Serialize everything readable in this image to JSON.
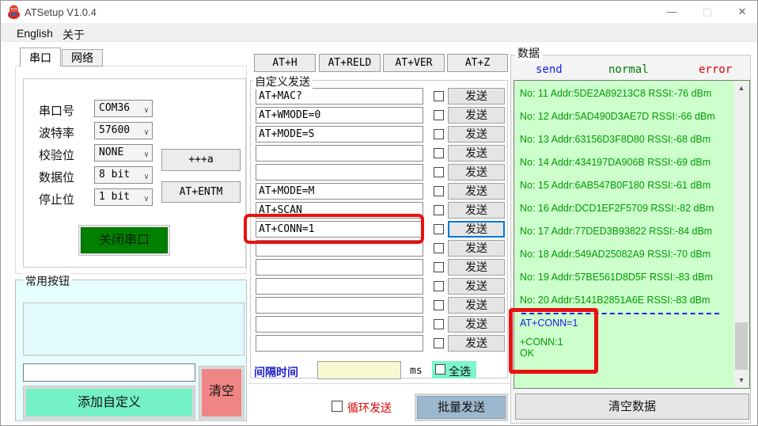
{
  "window": {
    "title": "ATSetup V1.0.4",
    "minimize_glyph": "—",
    "maximize_glyph": "▢",
    "close_glyph": "✕"
  },
  "menu": {
    "items": [
      {
        "label": "English"
      },
      {
        "label": "关于"
      }
    ]
  },
  "serial_panel": {
    "tabs": [
      {
        "label": "串口",
        "active": true
      },
      {
        "label": "网络",
        "active": false
      }
    ],
    "fields": [
      {
        "label": "串口号",
        "value": "COM36"
      },
      {
        "label": "波特率",
        "value": "57600"
      },
      {
        "label": "校验位",
        "value": "NONE"
      },
      {
        "label": "数据位",
        "value": "8 bit"
      },
      {
        "label": "停止位",
        "value": "1 bit"
      }
    ],
    "plus_a_button": "+++a",
    "entm_button": "AT+ENTM",
    "close_port_button": "关闭串口"
  },
  "common_buttons": {
    "title": "常用按钮",
    "input_value": "",
    "add_button": "添加自定义",
    "clear_button": "清空"
  },
  "quick_commands": [
    "AT+H",
    "AT+RELD",
    "AT+VER",
    "AT+Z"
  ],
  "custom_send": {
    "title": "自定义发送",
    "send_label": "发送",
    "rows": [
      {
        "value": "AT+MAC?",
        "checked": false
      },
      {
        "value": "AT+WMODE=0",
        "checked": false
      },
      {
        "value": "AT+MODE=S",
        "checked": false
      },
      {
        "value": "",
        "checked": false
      },
      {
        "value": "",
        "checked": false
      },
      {
        "value": "AT+MODE=M",
        "checked": false
      },
      {
        "value": "AT+SCAN",
        "checked": false
      },
      {
        "value": "AT+CONN=1",
        "checked": false,
        "highlighted": true,
        "send_focused": true
      },
      {
        "value": "",
        "checked": false
      },
      {
        "value": "",
        "checked": false
      },
      {
        "value": "",
        "checked": false
      },
      {
        "value": "",
        "checked": false
      },
      {
        "value": "",
        "checked": false
      },
      {
        "value": "",
        "checked": false
      }
    ],
    "interval_label": "间隔时间",
    "interval_value": "",
    "interval_unit": "ms",
    "select_all_label": "全选",
    "select_all_checked": false,
    "loop_send_label": "循环发送",
    "loop_send_checked": false,
    "batch_send_button": "批量发送"
  },
  "data_panel": {
    "title": "数据",
    "legend": [
      {
        "label": "send",
        "color": "#1a1aee"
      },
      {
        "label": "normal",
        "color": "#007d00"
      },
      {
        "label": "error",
        "color": "#e00000"
      }
    ],
    "lines": [
      {
        "kind": "rx",
        "text": "No: 11 Addr:5DE2A89213C8 RSSI:-76 dBm"
      },
      {
        "kind": "rx",
        "text": "No: 12 Addr:5AD490D3AE7D RSSI:-66 dBm"
      },
      {
        "kind": "rx",
        "text": "No: 13 Addr:63156D3F8D80 RSSI:-68 dBm"
      },
      {
        "kind": "rx",
        "text": "No: 14 Addr:434197DA906B RSSI:-69 dBm"
      },
      {
        "kind": "rx",
        "text": "No: 15 Addr:6AB547B0F180 RSSI:-61 dBm"
      },
      {
        "kind": "rx",
        "text": "No: 16 Addr:DCD1EF2F5709 RSSI:-82 dBm"
      },
      {
        "kind": "rx",
        "text": "No: 17 Addr:77DED3B93822 RSSI:-84 dBm"
      },
      {
        "kind": "rx",
        "text": "No: 18 Addr:549AD25082A9 RSSI:-70 dBm"
      },
      {
        "kind": "rx",
        "text": "No: 19 Addr:57BE561D8D5F RSSI:-83 dBm"
      },
      {
        "kind": "rx",
        "text": "No: 20 Addr:5141B2851A6E RSSI:-83 dBm"
      },
      {
        "kind": "dashed",
        "text": ""
      },
      {
        "kind": "tx",
        "text": "AT+CONN=1"
      },
      {
        "kind": "resp",
        "text": "+CONN:1"
      },
      {
        "kind": "resp",
        "text": "OK"
      }
    ],
    "clear_button": "清空数据"
  },
  "colors": {
    "close_port_green": "#008000",
    "add_button_mint": "#74f2c6",
    "clear_button_salmon": "#ef8585",
    "batch_button_blue": "#9db7ce",
    "terminal_bg_green": "#ccffcc",
    "rx_text_green": "#009b00",
    "tx_text_blue": "#1a1aee",
    "annotation_red": "#e81111",
    "focus_ring_blue": "#0078d7",
    "interval_input_yellow": "#fafad2",
    "select_all_mint": "#7df5cd"
  }
}
